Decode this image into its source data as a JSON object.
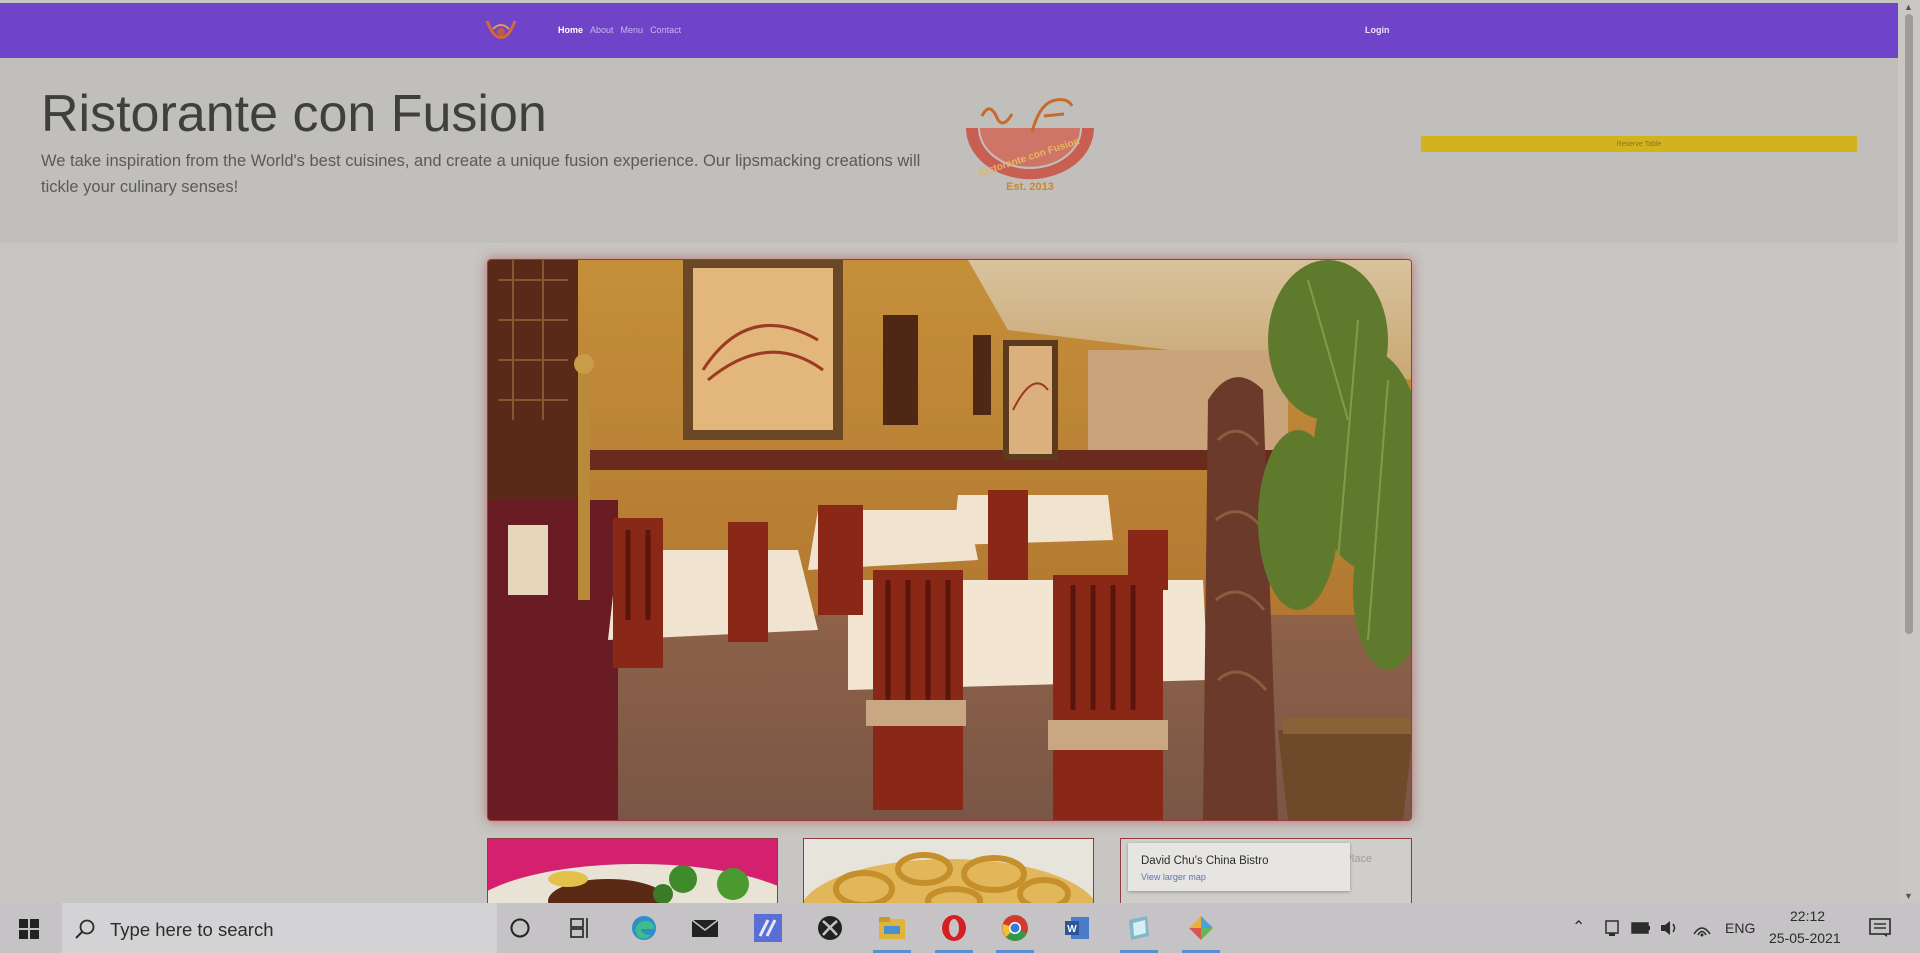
{
  "navbar": {
    "links": [
      {
        "label": "Home",
        "active": true
      },
      {
        "label": "About",
        "active": false
      },
      {
        "label": "Menu",
        "active": false
      },
      {
        "label": "Contact",
        "active": false
      }
    ],
    "login_label": "Login"
  },
  "jumbotron": {
    "title": "Ristorante con Fusion",
    "text": "We take inspiration from the World's best cuisines, and create a unique fusion experience. Our lipsmacking creations will tickle your culinary senses!",
    "logo_text": "Ristorante con Fusion",
    "logo_est": "Est. 2013",
    "reserve_label": "Reserve Table"
  },
  "map_card": {
    "title": "David Chu's China Bistro",
    "link": "View larger map",
    "bg_text": "k Place"
  },
  "taskbar": {
    "search_placeholder": "Type here to search",
    "language": "ENG",
    "time": "22:12",
    "date": "25-05-2021",
    "icons": [
      "cortana-icon",
      "task-view-icon",
      "edge-icon",
      "mail-icon",
      "app-icon",
      "xbox-icon",
      "file-explorer-icon",
      "opera-icon",
      "chrome-icon",
      "word-icon",
      "notepad-icon",
      "paint-icon"
    ]
  },
  "colors": {
    "navbar": "#7044c8",
    "reserve_button": "#d2b21d",
    "overlay_background": "#c7c6c2"
  }
}
